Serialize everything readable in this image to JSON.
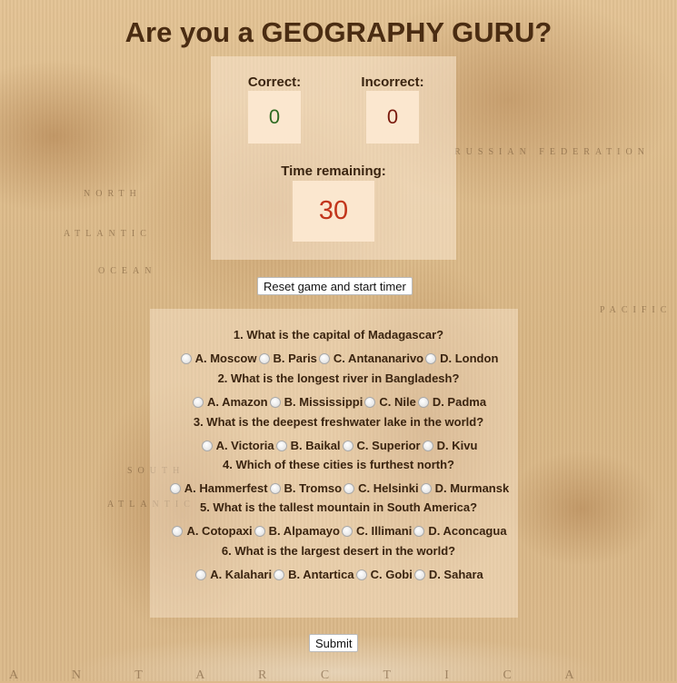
{
  "title": "Are you a GEOGRAPHY GURU?",
  "scoreboard": {
    "correct_label": "Correct:",
    "correct_value": "0",
    "incorrect_label": "Incorrect:",
    "incorrect_value": "0",
    "time_label": "Time remaining:",
    "time_value": "30",
    "colors": {
      "correct": "#2e6b22",
      "incorrect": "#7a1a0e",
      "time": "#c2351b"
    }
  },
  "reset_button": "Reset game and start timer",
  "questions": [
    {
      "text": "1. What is the capital of Madagascar?",
      "options": [
        "A. Moscow",
        "B. Paris",
        "C. Antananarivo",
        "D. London"
      ]
    },
    {
      "text": "2. What is the longest river in Bangladesh?",
      "options": [
        "A. Amazon",
        "B. Mississippi",
        "C. Nile",
        "D. Padma"
      ]
    },
    {
      "text": "3. What is the deepest freshwater lake in the world?",
      "options": [
        "A. Victoria",
        "B. Baikal",
        "C. Superior",
        "D. Kivu"
      ]
    },
    {
      "text": "4. Which of these cities is furthest north?",
      "options": [
        "A. Hammerfest",
        "B. Tromso",
        "C. Helsinki",
        "D. Murmansk"
      ]
    },
    {
      "text": "5. What is the tallest mountain in South America?",
      "options": [
        "A. Cotopaxi",
        "B. Alpamayo",
        "C. Illimani",
        "D. Aconcagua"
      ]
    },
    {
      "text": "6. What is the largest desert in the world?",
      "options": [
        "A. Kalahari",
        "B. Antartica",
        "C. Gobi",
        "D. Sahara"
      ]
    }
  ],
  "submit_button": "Submit",
  "map_labels": {
    "north": "NORTH",
    "atlantic": "ATLANTIC",
    "ocean": "OCEAN",
    "south": "SOUTH",
    "atlantic_s": "ATLANTIC",
    "russia": "RUSSIAN  FEDERATION",
    "pacific": "PACIFIC",
    "antarctica": "A N T A R C T I C A"
  }
}
